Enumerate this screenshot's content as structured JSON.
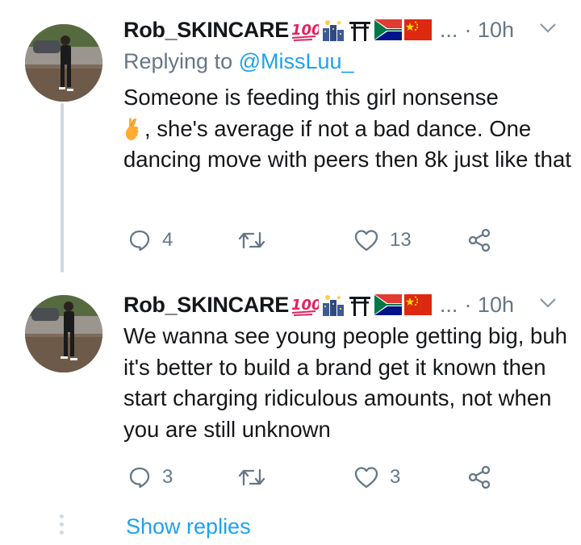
{
  "tweets": [
    {
      "author": "Rob_SKINCARE",
      "badges": [
        "hundred-points-emoji",
        "night-city-emoji",
        "shrine-emoji",
        "south-africa-flag-emoji",
        "china-flag-emoji"
      ],
      "ellipsis": "...",
      "time": "· 10h",
      "replying_prefix": "Replying to ",
      "replying_handle": "@MissLuu_",
      "text_part1": "Someone is feeding this girl nonsense",
      "text_part2": ", she's average if not a bad dance. One dancing move with peers then 8k just like that",
      "reply_count": "4",
      "retweet_count": "",
      "like_count": "13"
    },
    {
      "author": "Rob_SKINCARE",
      "badges": [
        "hundred-points-emoji",
        "night-city-emoji",
        "shrine-emoji",
        "south-africa-flag-emoji",
        "china-flag-emoji"
      ],
      "ellipsis": "...",
      "time": "· 10h",
      "text": "We wanna see young people getting big, buh it's better to build a brand get it known then start charging ridiculous amounts, not when you are still unknown",
      "reply_count": "3",
      "retweet_count": "",
      "like_count": "3"
    }
  ],
  "show_replies": "Show replies",
  "colors": {
    "accent": "#1da1f2",
    "secondary": "#657786",
    "thread_line": "#cfd9de"
  }
}
